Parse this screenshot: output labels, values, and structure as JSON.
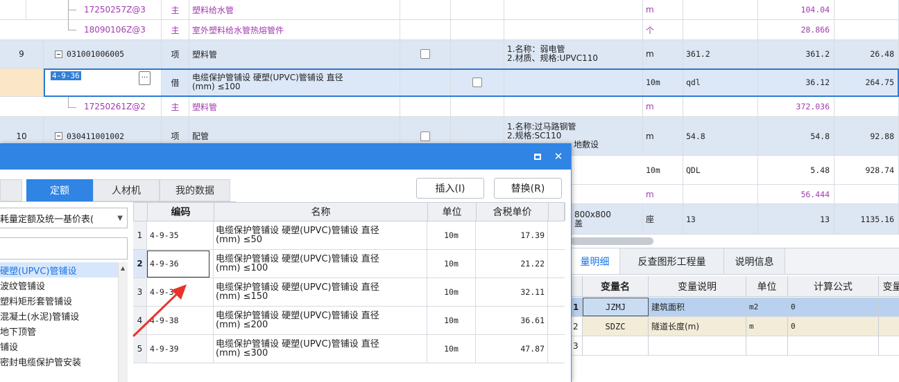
{
  "grid_rows": [
    {
      "kind": "child",
      "seq": "",
      "code": "17250257Z@3",
      "type": "主",
      "name": "塑料给水管",
      "name2": "",
      "feature1": "",
      "feature2": "",
      "unit": "m",
      "qty_expr": "",
      "qty": "104.04",
      "price": ""
    },
    {
      "kind": "child",
      "seq": "",
      "code": "18090106Z@3",
      "type": "主",
      "name": "室外塑料给水管热熔管件",
      "name2": "",
      "feature1": "",
      "feature2": "",
      "unit": "个",
      "qty_expr": "",
      "qty": "28.866",
      "price": ""
    },
    {
      "kind": "main",
      "seq": "9",
      "code": "031001006005",
      "type": "项",
      "name": "塑料管",
      "name2": "",
      "feature1": "1.名称：弱电管",
      "feature2": "2.材质、规格:UPVC110",
      "unit": "m",
      "qty_expr": "361.2",
      "qty": "361.2",
      "price": "26.48"
    },
    {
      "kind": "selected",
      "seq": "",
      "code": "4-9-36",
      "type": "借",
      "name": "电缆保护管铺设 硬塑(UPVC)管铺设 直径",
      "name2": "(mm) ≤100",
      "feature1": "",
      "feature2": "",
      "unit": "10m",
      "qty_expr": "qdl",
      "qty": "36.12",
      "price": "264.75"
    },
    {
      "kind": "child",
      "seq": "",
      "code": "17250261Z@2",
      "type": "主",
      "name": "塑料管",
      "name2": "",
      "feature1": "",
      "feature2": "",
      "unit": "m",
      "qty_expr": "",
      "qty": "372.036",
      "price": ""
    },
    {
      "kind": "main",
      "seq": "10",
      "code": "030411001002",
      "type": "项",
      "name": "配管",
      "name2": "",
      "feature1": "1.名称:过马路钢管",
      "feature2": "2.规格:SC110",
      "feature3": "地敷设",
      "unit": "m",
      "qty_expr": "54.8",
      "qty": "54.8",
      "price": "92.88"
    },
    {
      "kind": "child2",
      "seq": "",
      "code": "",
      "type": "",
      "name": "",
      "unit": "10m",
      "qty_expr": "QDL",
      "qty": "5.48",
      "price": "928.74"
    },
    {
      "kind": "child2",
      "seq": "",
      "code": "",
      "type": "",
      "name": "",
      "unit": "m",
      "qty_expr": "",
      "qty": "56.444",
      "price": ""
    },
    {
      "kind": "child2",
      "seq": "",
      "code": "",
      "type": "",
      "name": "800x800",
      "name2": "盖",
      "unit": "座",
      "qty_expr": "13",
      "qty": "13",
      "price": "1135.16"
    }
  ],
  "bottom_panel": {
    "tabs": [
      "量明细",
      "反查图形工程量",
      "说明信息"
    ],
    "columns": [
      "变量名",
      "变量说明",
      "单位",
      "计算公式",
      "变量"
    ],
    "rows": [
      {
        "idx": "1",
        "name": "JZMJ",
        "desc": "建筑面积",
        "unit": "m2",
        "formula": "0"
      },
      {
        "idx": "2",
        "name": "SDZC",
        "desc": "隧道长度(m)",
        "unit": "m",
        "formula": "0"
      },
      {
        "idx": "3",
        "name": "",
        "desc": "",
        "unit": "",
        "formula": ""
      }
    ]
  },
  "dialog": {
    "tabs": [
      "定额",
      "人材机",
      "我的数据"
    ],
    "insert_label": "插入(I)",
    "replace_label": "替换(R)",
    "library": "耗量定额及统一基价表(",
    "tree_items": [
      "硬塑(UPVC)管铺设",
      "波纹管铺设",
      "塑料矩形套管铺设",
      "混凝土(水泥)管铺设",
      "地下顶管",
      "铺设",
      "密封电缆保护管安装"
    ],
    "columns": [
      "编码",
      "名称",
      "单位",
      "含税单价"
    ],
    "rows": [
      {
        "idx": "1",
        "code": "4-9-35",
        "name": "电缆保护管铺设 硬塑(UPVC)管铺设 直径",
        "name2": "(mm) ≤50",
        "unit": "10m",
        "price": "17.39"
      },
      {
        "idx": "2",
        "code": "4-9-36",
        "name": "电缆保护管铺设 硬塑(UPVC)管铺设 直径",
        "name2": "(mm) ≤100",
        "unit": "10m",
        "price": "21.22"
      },
      {
        "idx": "3",
        "code": "4-9-37",
        "name": "电缆保护管铺设 硬塑(UPVC)管铺设 直径",
        "name2": "(mm) ≤150",
        "unit": "10m",
        "price": "32.11"
      },
      {
        "idx": "4",
        "code": "4-9-38",
        "name": "电缆保护管铺设 硬塑(UPVC)管铺设 直径",
        "name2": "(mm) ≤200",
        "unit": "10m",
        "price": "36.61"
      },
      {
        "idx": "5",
        "code": "4-9-39",
        "name": "电缆保护管铺设 硬塑(UPVC)管铺设 直径",
        "name2": "(mm) ≤300",
        "unit": "10m",
        "price": "47.87"
      }
    ]
  },
  "colors": {
    "accent": "#2f84e4",
    "purple_text": "#a239b0",
    "annotation": "#e8332a"
  }
}
